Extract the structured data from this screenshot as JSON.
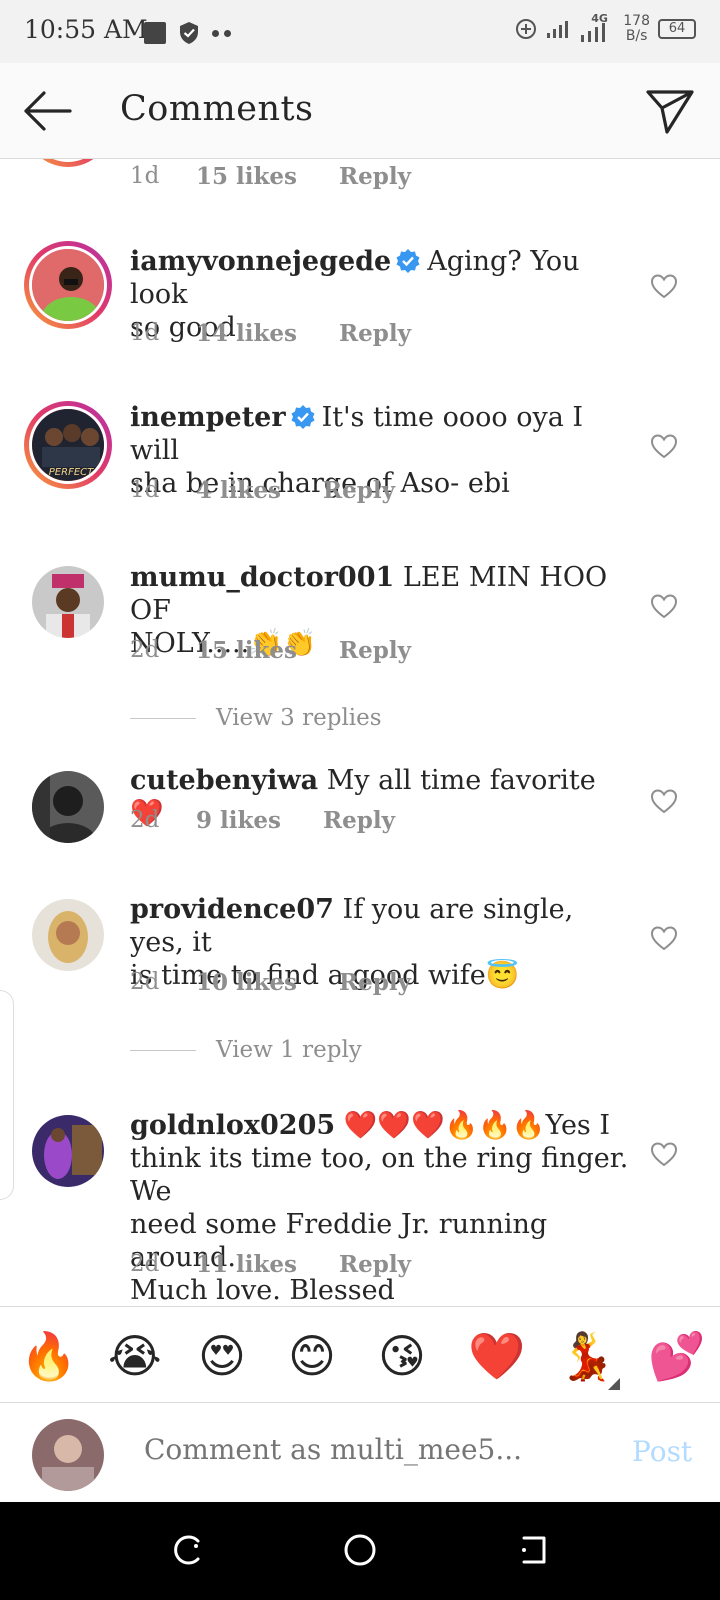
{
  "status_bar": {
    "time": "10:55 AM",
    "network_type": "4G",
    "speed_value": "178",
    "speed_unit": "B/s",
    "battery": "64"
  },
  "header": {
    "title": "Comments"
  },
  "partial_comment": {
    "time": "1d",
    "likes": "15 likes",
    "reply": "Reply"
  },
  "comments": [
    {
      "username": "iamyvonnejegede",
      "verified": true,
      "text_line1": "Aging? You look",
      "text_line2": "so good",
      "time": "1d",
      "likes": "14 likes",
      "reply": "Reply"
    },
    {
      "username": "inempeter",
      "verified": true,
      "text_line1": "It's time oooo oya I will",
      "text_line2": "sha be in charge of Aso- ebi",
      "time": "1d",
      "likes": "4 likes",
      "reply": "Reply",
      "avatar_caption": "PERFECT"
    },
    {
      "username": "mumu_doctor001",
      "verified": false,
      "text_line1": "LEE MIN HOO OF",
      "text_line2": "NOLY.....👏👏",
      "time": "2d",
      "likes": "15 likes",
      "reply": "Reply",
      "view_replies": "View 3 replies"
    },
    {
      "username": "cutebenyiwa",
      "verified": false,
      "text_line1": "My all time favorite ❤️",
      "time": "2d",
      "likes": "9 likes",
      "reply": "Reply"
    },
    {
      "username": "providence07",
      "verified": false,
      "text_line1": "If you are single, yes, it",
      "text_line2": "is time to find a good wife😇",
      "time": "2d",
      "likes": "10 likes",
      "reply": "Reply",
      "view_replies": "View 1 reply"
    },
    {
      "username": "goldnlox0205",
      "verified": false,
      "text_line1": "❤️❤️❤️🔥🔥🔥Yes I",
      "text_line2": "think its time too, on the ring finger. We",
      "text_line3": "need some Freddie Jr. running around.",
      "text_line4": "Much love. Blessed",
      "time": "2d",
      "likes": "11 likes",
      "reply": "Reply"
    }
  ],
  "emoji_bar": [
    "🔥",
    "😭",
    "😍",
    "😊",
    "😘",
    "❤️",
    "💃",
    "💕"
  ],
  "compose": {
    "placeholder": "Comment as multi_mee5...",
    "post_label": "Post"
  },
  "colors": {
    "verified_blue": "#3897f0",
    "meta_gray": "#8e8e8e",
    "post_disabled": "#b3dbff",
    "story_ring_start": "#f9a13a",
    "story_ring_end": "#b530a8"
  }
}
